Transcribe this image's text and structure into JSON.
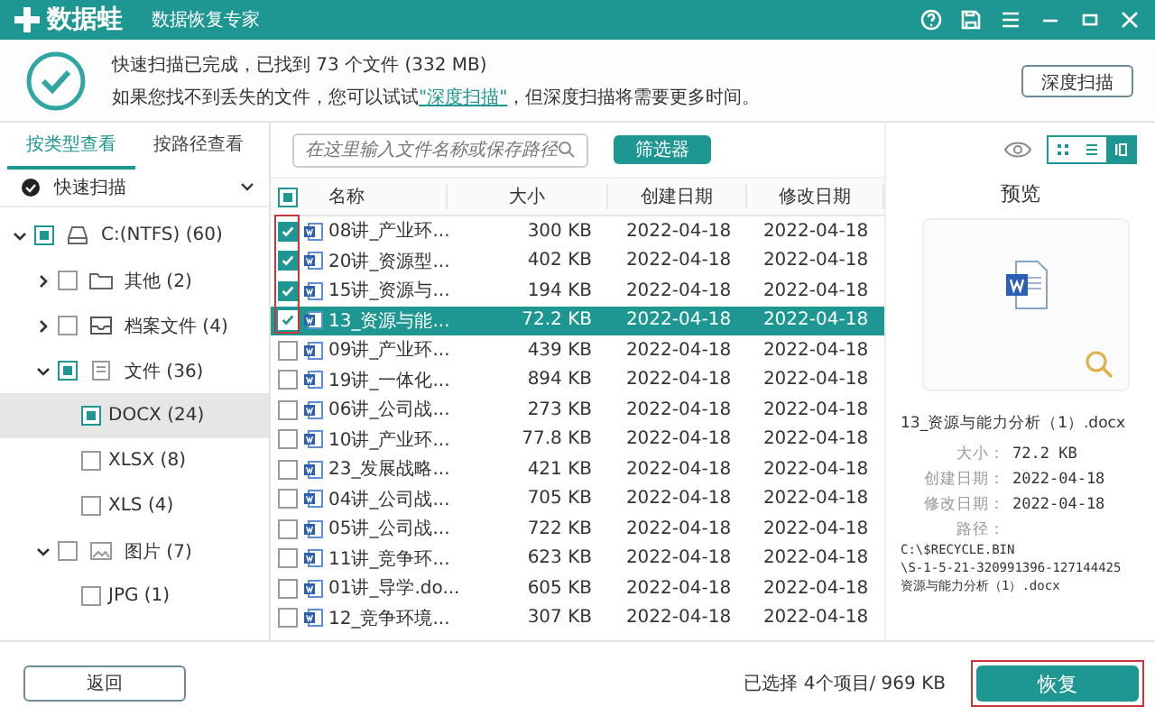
{
  "window": {
    "logo": "数据蛙",
    "subtitle": "数据恢复专家"
  },
  "scan_info": {
    "line_1": "快速扫描已完成，已找到 73 个文件 (332 MB)",
    "link": "\"深度扫描\"",
    "before_link": "如果您找不到丢失的文件，您可以试试",
    "after_link": "，但深度扫描将需要更多时间。",
    "button": "深度扫描"
  },
  "view_tabs": [
    {
      "label": "按类型查看",
      "selected": true
    },
    {
      "label": "按路径查看",
      "selected": false
    }
  ],
  "scan_mode": "快速扫描",
  "tree": [
    {
      "label": "C:(NTFS) (60)",
      "kind": "drive",
      "checked": true,
      "partial": true,
      "expanded": true,
      "selected": false,
      "children": [
        {
          "label": "其他 (2)",
          "kind": "folder",
          "checked": false,
          "partial": false,
          "expanded": false,
          "selected": false
        },
        {
          "label": "档案文件 (4)",
          "kind": "archive",
          "checked": false,
          "partial": false,
          "expanded": false,
          "selected": false
        },
        {
          "label": "文件 (36)",
          "kind": "document",
          "checked": true,
          "partial": true,
          "expanded": true,
          "selected": false,
          "children": [
            {
              "label": "DOCX (24)",
              "checked": true,
              "partial": true,
              "selected": true
            },
            {
              "label": "XLSX (8)",
              "checked": false,
              "partial": false,
              "selected": false
            },
            {
              "label": "XLS (4)",
              "checked": false,
              "partial": false,
              "selected": false
            }
          ]
        },
        {
          "label": "图片 (7)",
          "kind": "image",
          "checked": false,
          "partial": false,
          "expanded": true,
          "selected": false,
          "children": [
            {
              "label": "JPG (1)",
              "checked": false,
              "partial": false,
              "selected": false
            }
          ]
        }
      ]
    }
  ],
  "search": {
    "placeholder": "在这里输入文件名称或保存路径"
  },
  "filter_button": "筛选器",
  "table": {
    "header_checked": true,
    "header_partial": true,
    "columns": [
      "名称",
      "大小",
      "创建日期",
      "修改日期"
    ],
    "rows": [
      {
        "name": "08讲_产业环...",
        "size": "300 KB",
        "created": "2022-04-18",
        "modified": "2022-04-18",
        "checked": true,
        "selected": false
      },
      {
        "name": "20讲_资源型...",
        "size": "402 KB",
        "created": "2022-04-18",
        "modified": "2022-04-18",
        "checked": true,
        "selected": false
      },
      {
        "name": "15讲_资源与...",
        "size": "194 KB",
        "created": "2022-04-18",
        "modified": "2022-04-18",
        "checked": true,
        "selected": false
      },
      {
        "name": "13_资源与能...",
        "size": "72.2 KB",
        "created": "2022-04-18",
        "modified": "2022-04-18",
        "checked": true,
        "selected": true
      },
      {
        "name": "09讲_产业环...",
        "size": "439 KB",
        "created": "2022-04-18",
        "modified": "2022-04-18",
        "checked": false,
        "selected": false
      },
      {
        "name": "19讲_一体化...",
        "size": "894 KB",
        "created": "2022-04-18",
        "modified": "2022-04-18",
        "checked": false,
        "selected": false
      },
      {
        "name": "06讲_公司战...",
        "size": "273 KB",
        "created": "2022-04-18",
        "modified": "2022-04-18",
        "checked": false,
        "selected": false
      },
      {
        "name": "10讲_产业环...",
        "size": "77.8 KB",
        "created": "2022-04-18",
        "modified": "2022-04-18",
        "checked": false,
        "selected": false
      },
      {
        "name": "23_发展战略...",
        "size": "421 KB",
        "created": "2022-04-18",
        "modified": "2022-04-18",
        "checked": false,
        "selected": false
      },
      {
        "name": "04讲_公司战...",
        "size": "705 KB",
        "created": "2022-04-18",
        "modified": "2022-04-18",
        "checked": false,
        "selected": false
      },
      {
        "name": "05讲_公司战...",
        "size": "722 KB",
        "created": "2022-04-18",
        "modified": "2022-04-18",
        "checked": false,
        "selected": false
      },
      {
        "name": "11讲_竞争环...",
        "size": "623 KB",
        "created": "2022-04-18",
        "modified": "2022-04-18",
        "checked": false,
        "selected": false
      },
      {
        "name": "01讲_导学.do...",
        "size": "605 KB",
        "created": "2022-04-18",
        "modified": "2022-04-18",
        "checked": false,
        "selected": false
      },
      {
        "name": "12_竞争环境...",
        "size": "307 KB",
        "created": "2022-04-18",
        "modified": "2022-04-18",
        "checked": false,
        "selected": false
      }
    ]
  },
  "view_modes": [
    {
      "kind": "grid",
      "selected": false
    },
    {
      "kind": "list",
      "selected": false
    },
    {
      "kind": "detail",
      "selected": true
    }
  ],
  "preview": {
    "title": "预览",
    "file_name": "13_资源与能力分析（1）.docx",
    "details": [
      {
        "label": "大小：",
        "value": "72.2 KB"
      },
      {
        "label": "创建日期：",
        "value": "2022-04-18"
      },
      {
        "label": "修改日期：",
        "value": "2022-04-18"
      }
    ],
    "path_label": "路径：",
    "path_lines": [
      "C:\\$RECYCLE.BIN",
      "\\S-1-5-21-320991396-127144425",
      "资源与能力分析（1）.docx"
    ]
  },
  "footer": {
    "back_button": "返回",
    "selection": "已选择 4个项目/ 969 KB",
    "recover_button": "恢复"
  }
}
